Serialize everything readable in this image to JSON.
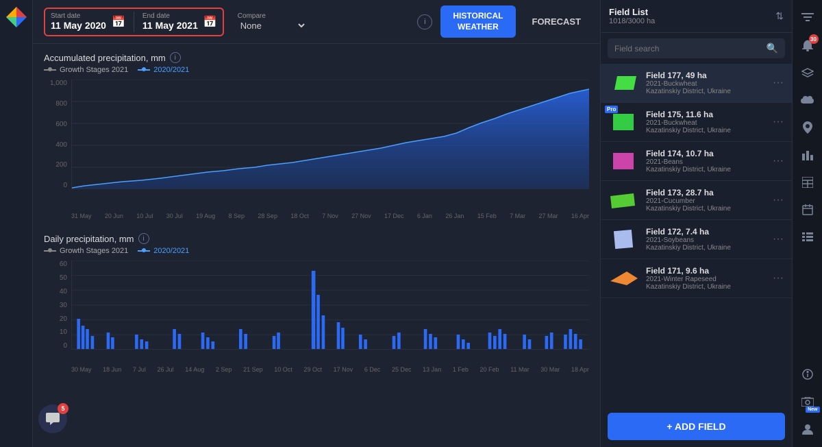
{
  "app": {
    "title": "Field List",
    "subtitle": "1018/3000 ha"
  },
  "topbar": {
    "start_date_label": "Start date",
    "start_date_value": "11 May 2020",
    "end_date_label": "End date",
    "end_date_value": "11 May 2021",
    "compare_label": "Compare",
    "compare_value": "None",
    "btn_historical": "HISTORICAL\nWEATHER",
    "btn_historical_line1": "HISTORICAL",
    "btn_historical_line2": "WEATHER",
    "btn_forecast": "FORECAST",
    "info_icon": "i"
  },
  "charts": {
    "accumulated_title": "Accumulated precipitation, mm",
    "daily_title": "Daily precipitation, mm",
    "legend_growth": "Growth Stages 2021",
    "legend_season": "2020/2021",
    "acc_y_labels": [
      "1,000",
      "800",
      "600",
      "400",
      "200",
      "0"
    ],
    "acc_x_labels": [
      "31 May",
      "20 Jun",
      "10 Jul",
      "30 Jul",
      "19 Aug",
      "8 Sep",
      "28 Sep",
      "18 Oct",
      "7 Nov",
      "27 Nov",
      "17 Dec",
      "6 Jan",
      "26 Jan",
      "15 Feb",
      "7 Mar",
      "27 Mar",
      "16 Apr"
    ],
    "daily_y_labels": [
      "60",
      "50",
      "40",
      "30",
      "20",
      "10",
      "0"
    ],
    "daily_x_labels": [
      "30 May",
      "18 Jun",
      "7 Jul",
      "26 Jul",
      "14 Aug",
      "2 Sep",
      "21 Sep",
      "10 Oct",
      "29 Oct",
      "17 Nov",
      "6 Dec",
      "25 Dec",
      "13 Jan",
      "1 Feb",
      "20 Feb",
      "11 Mar",
      "30 Mar",
      "18 Apr"
    ]
  },
  "search": {
    "placeholder": "Field search"
  },
  "fields": [
    {
      "id": "field-177",
      "name": "Field 177, 49 ha",
      "crop": "2021-Buckwheat",
      "location": "Kazatinskiy District, Ukraine",
      "color": "#44dd44",
      "shape": "parallelogram",
      "pro": false
    },
    {
      "id": "field-175",
      "name": "Field 175, 11.6 ha",
      "crop": "2021-Buckwheat",
      "location": "Kazatinskiy District, Ukraine",
      "color": "#33cc44",
      "shape": "square",
      "pro": true
    },
    {
      "id": "field-174",
      "name": "Field 174, 10.7 ha",
      "crop": "2021-Beans",
      "location": "Kazatinskiy District, Ukraine",
      "color": "#cc44aa",
      "shape": "square",
      "pro": false
    },
    {
      "id": "field-173",
      "name": "Field 173, 28.7 ha",
      "crop": "2021-Cucumber",
      "location": "Kazatinskiy District, Ukraine",
      "color": "#55cc33",
      "shape": "parallelogram",
      "pro": false
    },
    {
      "id": "field-172",
      "name": "Field 172, 7.4 ha",
      "crop": "2021-Soybeans",
      "location": "Kazatinskiy District, Ukraine",
      "color": "#aabbee",
      "shape": "square",
      "pro": false
    },
    {
      "id": "field-171",
      "name": "Field 171, 9.6 ha",
      "crop": "2021-Winter Rapeseed",
      "location": "Kazatinskiy District, Ukraine",
      "color": "#ee8833",
      "shape": "arrow",
      "pro": false
    }
  ],
  "add_field_btn": "+ ADD FIELD",
  "chat_badge": "5",
  "right_icons": {
    "filter": "≡",
    "bell": "🔔",
    "layers": "⬡",
    "cloud": "☁",
    "pin": "📍",
    "chart": "📊",
    "table": "⊞",
    "calendar": "📅",
    "list": "≡",
    "info": "ⓘ",
    "image": "🖼",
    "user": "👤",
    "badge_count": "30"
  }
}
